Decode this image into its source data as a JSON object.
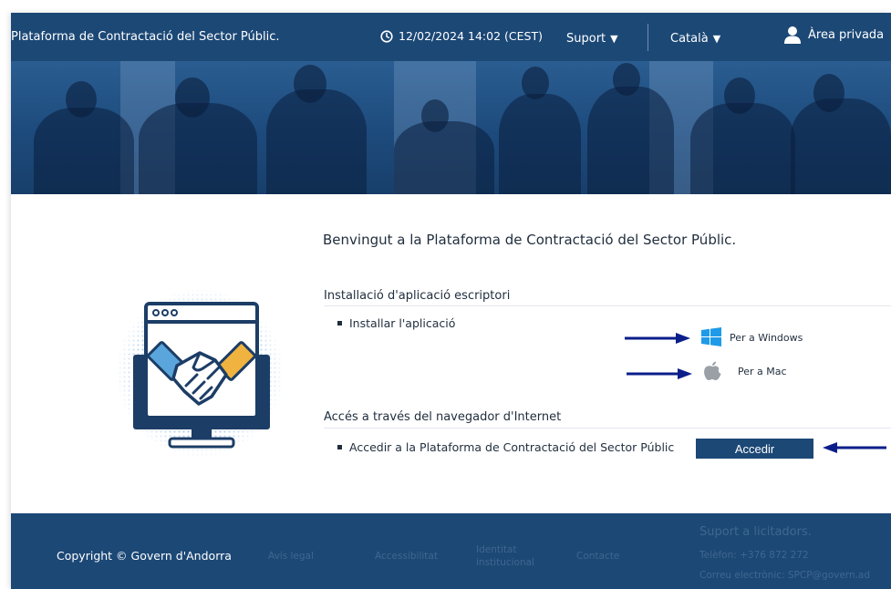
{
  "header": {
    "site_title": "Plataforma de Contractació del Sector Públic.",
    "datetime": "12/02/2024 14:02 (CEST)",
    "support_menu": "Suport",
    "language_menu": "Català",
    "private_area": "Àrea privada",
    "arrow_glyph": "▼"
  },
  "main": {
    "welcome": "Benvingut a la Plataforma de Contractació del Sector Públic.",
    "desktop_section": {
      "title": "Installació d'aplicació escriptori",
      "item": "Installar l'aplicació",
      "windows_link": "Per a Windows",
      "mac_link": "Per a Mac"
    },
    "browser_section": {
      "title": "Accés a través del navegador d'Internet",
      "item": "Accedir a la Plataforma de Contractació del Sector Públic",
      "button": "Accedir"
    }
  },
  "footer": {
    "copyright": "Copyright © Govern d'Andorra",
    "links": [
      "Avís legal",
      "Accessibilitat",
      "Identitat",
      "institucional",
      "Contacte"
    ],
    "support": {
      "title": "Suport a licitadors.",
      "phone": "Telèfon: +376 872 272",
      "email": "Correu electrònic: SPCP@govern.ad"
    }
  },
  "colors": {
    "brand_blue": "#1c4876",
    "arrow_blue": "#0b1e8a",
    "windows_blue": "#1e9be8",
    "apple_gray": "#9aa0a6"
  },
  "icons": [
    "clock-icon",
    "user-icon",
    "windows-icon",
    "apple-icon",
    "arrow-right-icon",
    "arrow-left-icon",
    "handshake-monitor-illustration"
  ]
}
